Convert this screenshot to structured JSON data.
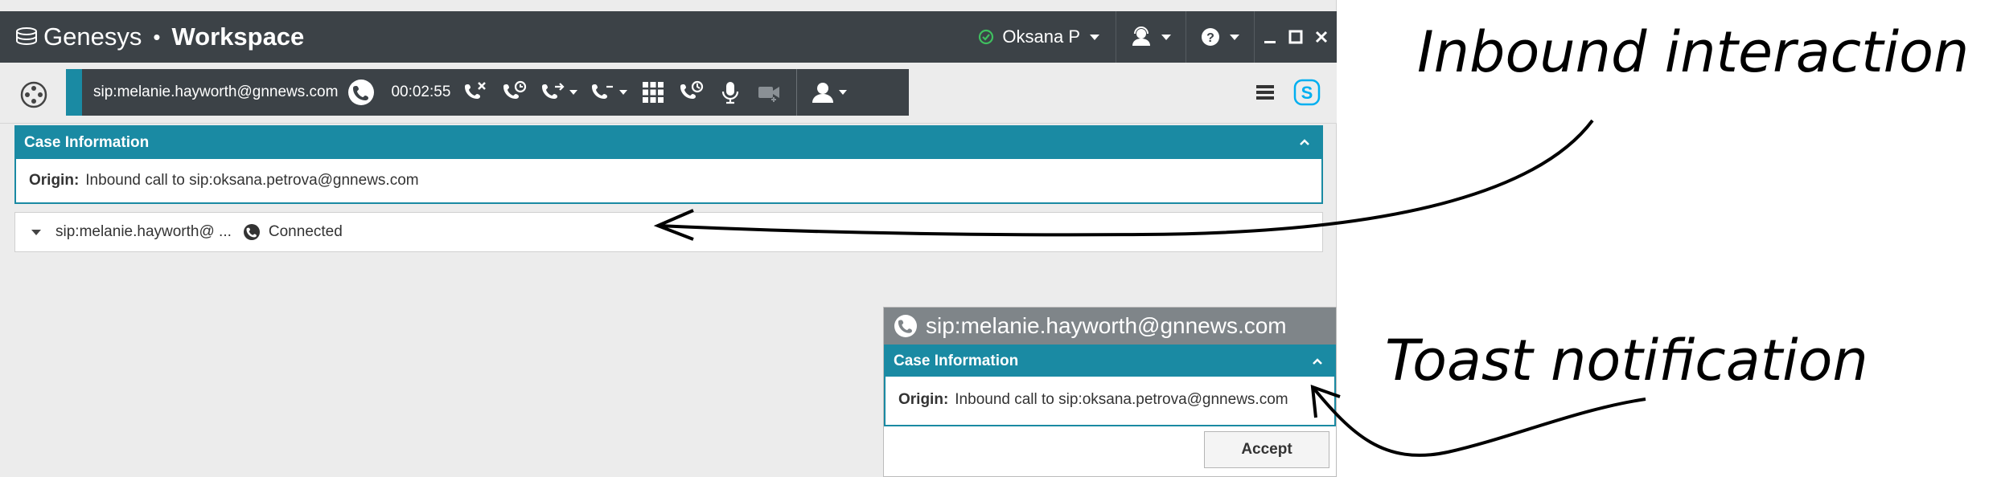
{
  "titlebar": {
    "brand": "Genesys",
    "separator": "•",
    "app_name": "Workspace",
    "user": "Oksana P",
    "status_color": "#3fbf5f"
  },
  "call": {
    "target": "sip:melanie.hayworth@gnnews.com",
    "timer": "00:02:55"
  },
  "case_info": {
    "title": "Case Information",
    "origin_label": "Origin:",
    "origin_value": "Inbound call to sip:oksana.petrova@gnnews.com"
  },
  "interaction": {
    "target": "sip:melanie.hayworth@ ...",
    "status": "Connected"
  },
  "toast": {
    "title": "sip:melanie.hayworth@gnnews.com",
    "case_title": "Case Information",
    "origin_label": "Origin:",
    "origin_value": "Inbound call to sip:oksana.petrova@gnnews.com",
    "accept_label": "Accept"
  },
  "annotations": {
    "inbound": "Inbound interaction",
    "toast": "Toast notification"
  },
  "colors": {
    "accent": "#1a8aa3",
    "titlebar": "#3c4247",
    "toast_header": "#7f8589",
    "skype": "#00aff0"
  }
}
